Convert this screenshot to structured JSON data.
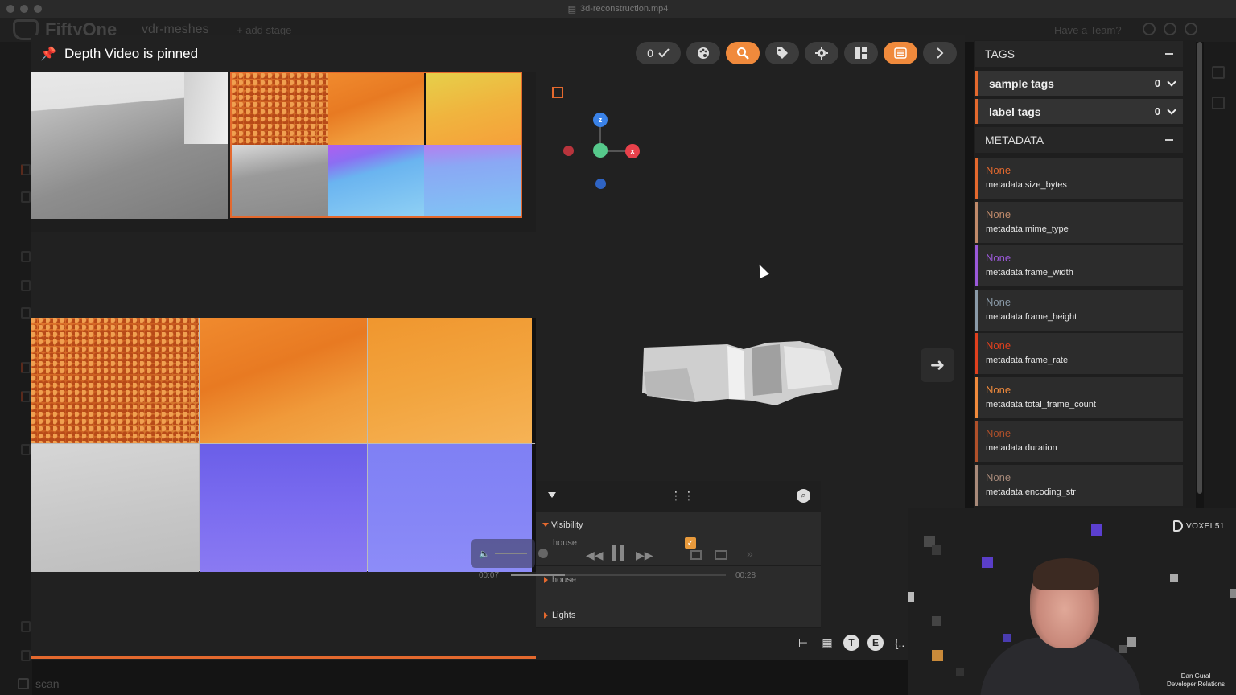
{
  "window": {
    "title": "3d-reconstruction.mp4"
  },
  "app": {
    "logo_text": "FiftyOne",
    "dataset": "vdr-meshes",
    "add_stage": "+ add stage",
    "have_team": "Have a Team?",
    "field_row_label": "scan"
  },
  "modal": {
    "title": "Depth Video is pinned",
    "toolbar": {
      "selected_count": "0",
      "icons": [
        "check-icon",
        "palette-icon",
        "search-icon",
        "tag-icon",
        "gear-icon",
        "layout-icon",
        "list-icon",
        "chevron-right-icon"
      ]
    },
    "accent_color": "#e4692e"
  },
  "gizmo": {
    "axes": [
      "z",
      "x"
    ]
  },
  "scene_panel": {
    "sections": [
      {
        "label": "Visibility",
        "expanded": true,
        "children": [
          "house"
        ]
      },
      {
        "label": "house",
        "expanded": false
      },
      {
        "label": "Lights",
        "expanded": false
      }
    ]
  },
  "video_controls": {
    "current_time": "00:07",
    "duration": "00:28",
    "progress": 0.25
  },
  "bottom_toolbar": {
    "icons": [
      "hierarchy-icon",
      "grid-icon",
      "t-icon",
      "e-icon",
      "json-icon"
    ],
    "t_label": "T",
    "e_label": "E",
    "json_label": "{.."
  },
  "sidebar": {
    "tags_header": "TAGS",
    "tag_rows": [
      {
        "label": "sample tags",
        "count": "0"
      },
      {
        "label": "label tags",
        "count": "0"
      }
    ],
    "metadata_header": "METADATA",
    "metadata_rows": [
      {
        "value": "None",
        "key": "metadata.size_bytes",
        "color": "#e4692e"
      },
      {
        "value": "None",
        "key": "metadata.mime_type",
        "color": "#c08a6a"
      },
      {
        "value": "None",
        "key": "metadata.frame_width",
        "color": "#9b59d9"
      },
      {
        "value": "None",
        "key": "metadata.frame_height",
        "color": "#8a9aa8"
      },
      {
        "value": "None",
        "key": "metadata.frame_rate",
        "color": "#e0401e"
      },
      {
        "value": "None",
        "key": "metadata.total_frame_count",
        "color": "#f08a3c"
      },
      {
        "value": "None",
        "key": "metadata.duration",
        "color": "#b0502a"
      },
      {
        "value": "None",
        "key": "metadata.encoding_str",
        "color": "#a88a7a"
      }
    ]
  },
  "webcam": {
    "brand": "VOXEL51",
    "name": "Dan Gural",
    "role": "Developer Relations"
  }
}
